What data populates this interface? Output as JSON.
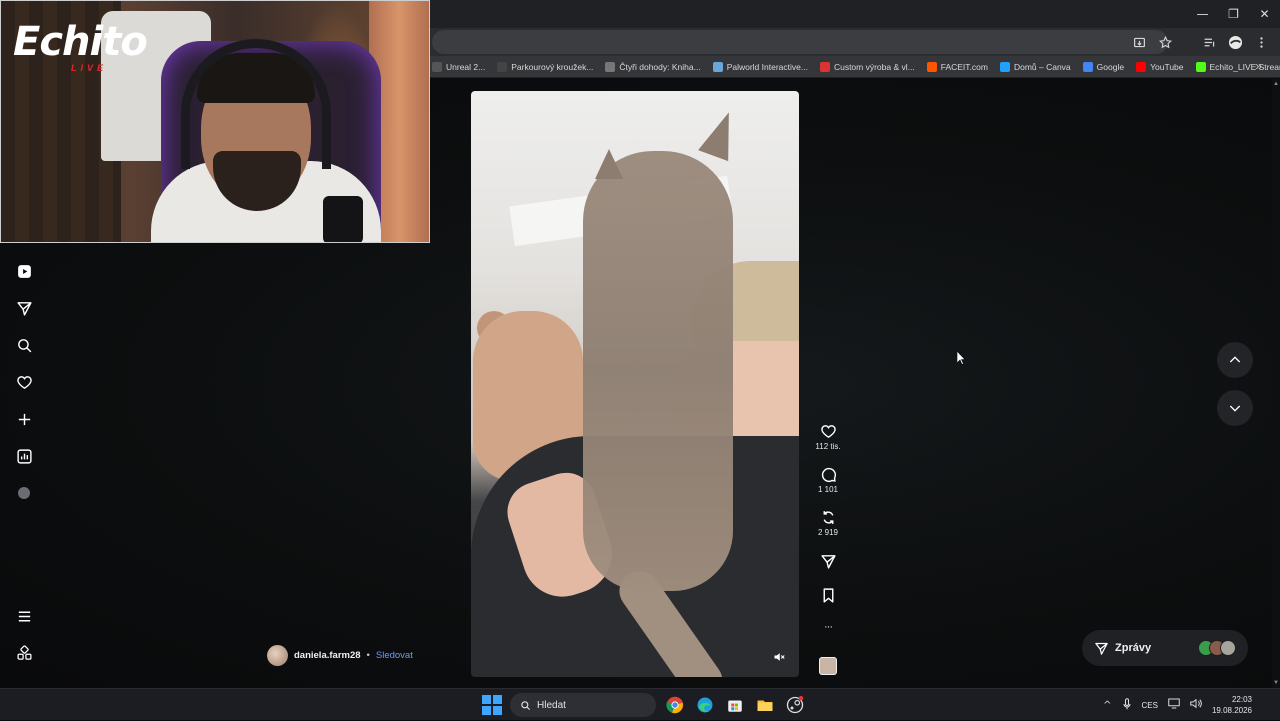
{
  "window": {
    "minimize_label": "—",
    "maximize_label": "❐",
    "close_label": "✕"
  },
  "bookmarks": [
    {
      "label": "Unreal 2...",
      "color": "#555"
    },
    {
      "label": "Parkourový kroužek...",
      "color": "#444"
    },
    {
      "label": "Čtyři dohody: Kniha...",
      "color": "#777"
    },
    {
      "label": "Palworld Interactive...",
      "color": "#6aa7d8"
    },
    {
      "label": "Custom výroba & vl...",
      "color": "#d33"
    },
    {
      "label": "FACEIT.com",
      "color": "#ff5500"
    },
    {
      "label": "Domů – Canva",
      "color": "#20a0ff"
    },
    {
      "label": "Google",
      "color": "#4285f4"
    },
    {
      "label": "YouTube",
      "color": "#ff0000"
    },
    {
      "label": "Echito_LIVE Stream...",
      "color": "#53fc18"
    }
  ],
  "bookmarks_more": "»",
  "webcam": {
    "logo": "Echito",
    "logo_sub": "LIVE"
  },
  "sidebar": {
    "items": [
      "reels-icon",
      "send-icon",
      "search-icon",
      "heart-icon",
      "plus-icon",
      "insights-icon",
      "profile-avatar",
      "menu-icon",
      "apps-icon"
    ]
  },
  "post": {
    "author": "daniela.farm28",
    "separator": "•",
    "follow": "Sledovat"
  },
  "actions": {
    "likes": "112 tis.",
    "comments": "1 101",
    "reposts": "2 919",
    "more": "···"
  },
  "messages": {
    "label": "Zprávy"
  },
  "taskbar": {
    "search_placeholder": "Hledat",
    "language": "CES",
    "time": "22:03",
    "date": "19.08.2026"
  },
  "colors": {
    "accent_link": "#6a9cff",
    "windows_blue": "#3ea6ff"
  }
}
